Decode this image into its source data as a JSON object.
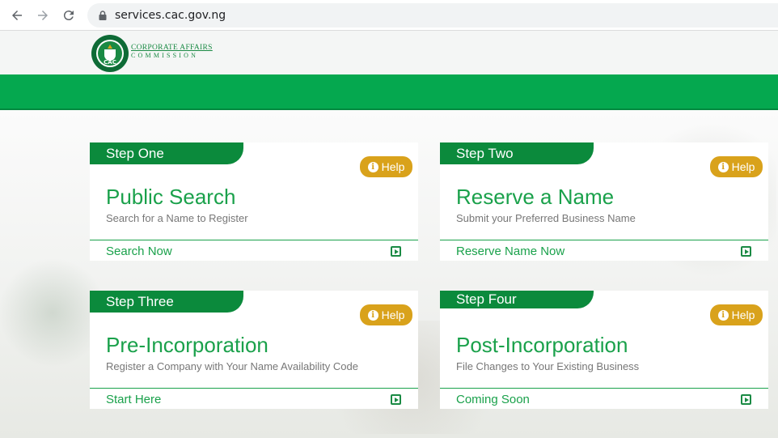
{
  "browser": {
    "url": "services.cac.gov.ng"
  },
  "header": {
    "logo_line1": "CORPORATE AFFAIRS",
    "logo_line2": "COMMISSION",
    "seal_text": "CAC",
    "brand_color": "#05a84f"
  },
  "cards": [
    {
      "step": "Step One",
      "title": "Public Search",
      "subtitle": "Search for a Name to Register",
      "action": "Search Now",
      "help": "Help"
    },
    {
      "step": "Step Two",
      "title": "Reserve a Name",
      "subtitle": "Submit your Preferred Business Name",
      "action": "Reserve Name Now",
      "help": "Help"
    },
    {
      "step": "Step Three",
      "title": "Pre-Incorporation",
      "subtitle": "Register a Company with Your Name Availability Code",
      "action": "Start Here",
      "help": "Help"
    },
    {
      "step": "Step Four",
      "title": "Post-Incorporation",
      "subtitle": "File Changes to Your Existing Business",
      "action": "Coming Soon",
      "help": "Help"
    }
  ],
  "colors": {
    "step_tab": "#0b8a3c",
    "help": "#d9a21b",
    "text_green": "#1aa14b"
  }
}
